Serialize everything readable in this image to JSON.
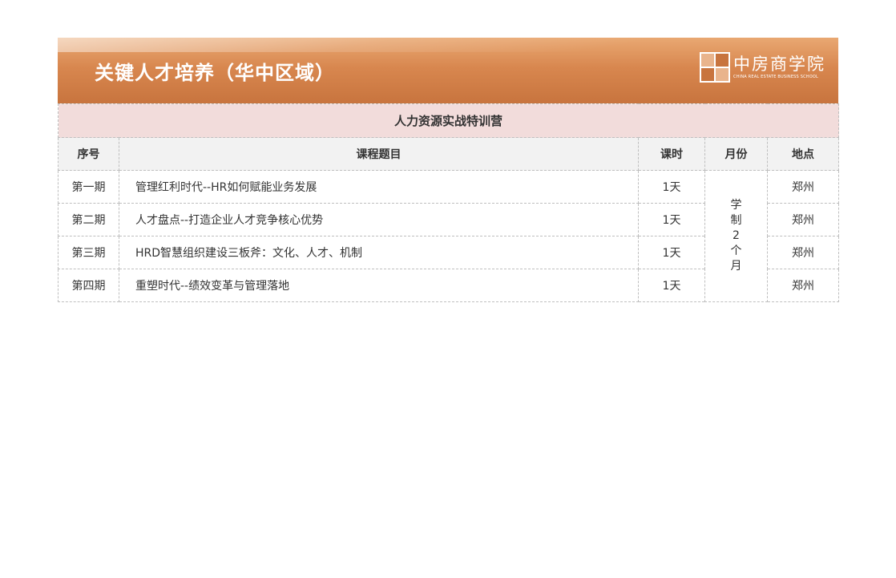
{
  "header": {
    "title": "关键人才培养（华中区域）",
    "logo_cn": "中房商学院",
    "logo_en": "CHINA REAL ESTATE BUSINESS SCHOOL",
    "brand_color": "#d8874f"
  },
  "table": {
    "camp_title": "人力资源实战特训营",
    "columns": [
      "序号",
      "课程题目",
      "课时",
      "月份",
      "地点"
    ],
    "rows": [
      {
        "seq": "第一期",
        "topic": "管理红利时代--HR如何赋能业务发展",
        "hours": "1天",
        "location": "郑州"
      },
      {
        "seq": "第二期",
        "topic": "人才盘点--打造企业人才竞争核心优势",
        "hours": "1天",
        "location": "郑州"
      },
      {
        "seq": "第三期",
        "topic": "HRD智慧组织建设三板斧：文化、人才、机制",
        "hours": "1天",
        "location": "郑州"
      },
      {
        "seq": "第四期",
        "topic": "重塑时代--绩效变革与管理落地",
        "hours": "1天",
        "location": "郑州"
      }
    ],
    "month_chars": [
      "学",
      "制",
      "2",
      "个",
      "月"
    ],
    "camp_bg": "#f2dcdb",
    "header_bg": "#f2f2f2"
  }
}
